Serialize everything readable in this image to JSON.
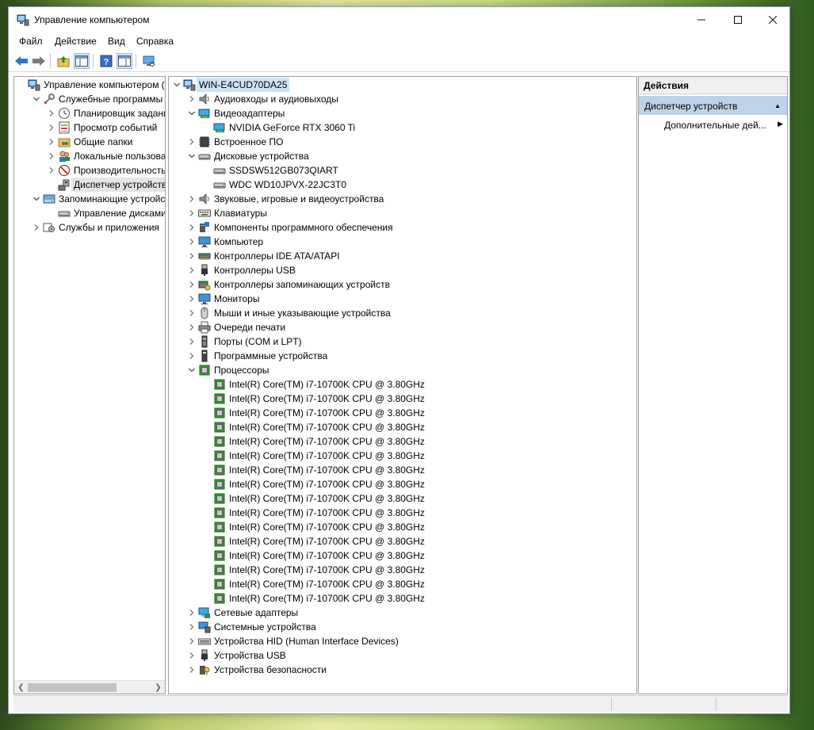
{
  "window": {
    "title": "Управление компьютером"
  },
  "menu": [
    "Файл",
    "Действие",
    "Вид",
    "Справка"
  ],
  "left_tree": [
    {
      "label": "Управление компьютером (л",
      "level": 0,
      "chev": "",
      "icon": "computer-management-icon"
    },
    {
      "label": "Служебные программы",
      "level": 1,
      "chev": "down",
      "icon": "system-tools-icon"
    },
    {
      "label": "Планировщик заданий",
      "level": 2,
      "chev": "right",
      "icon": "task-scheduler-icon"
    },
    {
      "label": "Просмотр событий",
      "level": 2,
      "chev": "right",
      "icon": "event-viewer-icon"
    },
    {
      "label": "Общие папки",
      "level": 2,
      "chev": "right",
      "icon": "shared-folders-icon"
    },
    {
      "label": "Локальные пользовате",
      "level": 2,
      "chev": "right",
      "icon": "local-users-icon"
    },
    {
      "label": "Производительность",
      "level": 2,
      "chev": "right",
      "icon": "performance-icon"
    },
    {
      "label": "Диспетчер устройств",
      "level": 2,
      "chev": "",
      "icon": "device-manager-icon",
      "selected": true
    },
    {
      "label": "Запоминающие устройст",
      "level": 1,
      "chev": "down",
      "icon": "storage-icon"
    },
    {
      "label": "Управление дисками",
      "level": 2,
      "chev": "",
      "icon": "disk-management-icon"
    },
    {
      "label": "Службы и приложения",
      "level": 1,
      "chev": "right",
      "icon": "services-apps-icon"
    }
  ],
  "device_tree": [
    {
      "label": "WIN-E4CUD70DA25",
      "level": 0,
      "chev": "down",
      "icon": "computer-icon",
      "root": true
    },
    {
      "label": "Аудиовходы и аудиовыходы",
      "level": 1,
      "chev": "right",
      "icon": "audio-icon"
    },
    {
      "label": "Видеоадаптеры",
      "level": 1,
      "chev": "down",
      "icon": "display-adapter-icon"
    },
    {
      "label": "NVIDIA GeForce RTX 3060 Ti",
      "level": 2,
      "chev": "",
      "icon": "display-adapter-icon"
    },
    {
      "label": "Встроенное ПО",
      "level": 1,
      "chev": "right",
      "icon": "firmware-icon"
    },
    {
      "label": "Дисковые устройства",
      "level": 1,
      "chev": "down",
      "icon": "disk-drive-icon"
    },
    {
      "label": "SSDSW512GB073QIART",
      "level": 2,
      "chev": "",
      "icon": "disk-drive-icon"
    },
    {
      "label": "WDC WD10JPVX-22JC3T0",
      "level": 2,
      "chev": "",
      "icon": "disk-drive-icon"
    },
    {
      "label": "Звуковые, игровые и видеоустройства",
      "level": 1,
      "chev": "right",
      "icon": "speaker-icon"
    },
    {
      "label": "Клавиатуры",
      "level": 1,
      "chev": "right",
      "icon": "keyboard-icon"
    },
    {
      "label": "Компоненты программного обеспечения",
      "level": 1,
      "chev": "right",
      "icon": "software-component-icon"
    },
    {
      "label": "Компьютер",
      "level": 1,
      "chev": "right",
      "icon": "monitor-icon"
    },
    {
      "label": "Контроллеры IDE ATA/ATAPI",
      "level": 1,
      "chev": "right",
      "icon": "ide-controller-icon"
    },
    {
      "label": "Контроллеры USB",
      "level": 1,
      "chev": "right",
      "icon": "usb-icon"
    },
    {
      "label": "Контроллеры запоминающих устройств",
      "level": 1,
      "chev": "right",
      "icon": "storage-controller-icon"
    },
    {
      "label": "Мониторы",
      "level": 1,
      "chev": "right",
      "icon": "monitor-icon"
    },
    {
      "label": "Мыши и иные указывающие устройства",
      "level": 1,
      "chev": "right",
      "icon": "mouse-icon"
    },
    {
      "label": "Очереди печати",
      "level": 1,
      "chev": "right",
      "icon": "printer-icon"
    },
    {
      "label": "Порты (COM и LPT)",
      "level": 1,
      "chev": "right",
      "icon": "port-icon"
    },
    {
      "label": "Программные устройства",
      "level": 1,
      "chev": "right",
      "icon": "software-device-icon"
    },
    {
      "label": "Процессоры",
      "level": 1,
      "chev": "down",
      "icon": "cpu-icon"
    },
    {
      "label": "Intel(R) Core(TM) i7-10700K CPU @ 3.80GHz",
      "level": 2,
      "chev": "",
      "icon": "cpu-icon"
    },
    {
      "label": "Intel(R) Core(TM) i7-10700K CPU @ 3.80GHz",
      "level": 2,
      "chev": "",
      "icon": "cpu-icon"
    },
    {
      "label": "Intel(R) Core(TM) i7-10700K CPU @ 3.80GHz",
      "level": 2,
      "chev": "",
      "icon": "cpu-icon"
    },
    {
      "label": "Intel(R) Core(TM) i7-10700K CPU @ 3.80GHz",
      "level": 2,
      "chev": "",
      "icon": "cpu-icon"
    },
    {
      "label": "Intel(R) Core(TM) i7-10700K CPU @ 3.80GHz",
      "level": 2,
      "chev": "",
      "icon": "cpu-icon"
    },
    {
      "label": "Intel(R) Core(TM) i7-10700K CPU @ 3.80GHz",
      "level": 2,
      "chev": "",
      "icon": "cpu-icon"
    },
    {
      "label": "Intel(R) Core(TM) i7-10700K CPU @ 3.80GHz",
      "level": 2,
      "chev": "",
      "icon": "cpu-icon"
    },
    {
      "label": "Intel(R) Core(TM) i7-10700K CPU @ 3.80GHz",
      "level": 2,
      "chev": "",
      "icon": "cpu-icon"
    },
    {
      "label": "Intel(R) Core(TM) i7-10700K CPU @ 3.80GHz",
      "level": 2,
      "chev": "",
      "icon": "cpu-icon"
    },
    {
      "label": "Intel(R) Core(TM) i7-10700K CPU @ 3.80GHz",
      "level": 2,
      "chev": "",
      "icon": "cpu-icon"
    },
    {
      "label": "Intel(R) Core(TM) i7-10700K CPU @ 3.80GHz",
      "level": 2,
      "chev": "",
      "icon": "cpu-icon"
    },
    {
      "label": "Intel(R) Core(TM) i7-10700K CPU @ 3.80GHz",
      "level": 2,
      "chev": "",
      "icon": "cpu-icon"
    },
    {
      "label": "Intel(R) Core(TM) i7-10700K CPU @ 3.80GHz",
      "level": 2,
      "chev": "",
      "icon": "cpu-icon"
    },
    {
      "label": "Intel(R) Core(TM) i7-10700K CPU @ 3.80GHz",
      "level": 2,
      "chev": "",
      "icon": "cpu-icon"
    },
    {
      "label": "Intel(R) Core(TM) i7-10700K CPU @ 3.80GHz",
      "level": 2,
      "chev": "",
      "icon": "cpu-icon"
    },
    {
      "label": "Intel(R) Core(TM) i7-10700K CPU @ 3.80GHz",
      "level": 2,
      "chev": "",
      "icon": "cpu-icon"
    },
    {
      "label": "Сетевые адаптеры",
      "level": 1,
      "chev": "right",
      "icon": "network-adapter-icon"
    },
    {
      "label": "Системные устройства",
      "level": 1,
      "chev": "right",
      "icon": "system-devices-icon"
    },
    {
      "label": "Устройства HID (Human Interface Devices)",
      "level": 1,
      "chev": "right",
      "icon": "hid-icon"
    },
    {
      "label": "Устройства USB",
      "level": 1,
      "chev": "right",
      "icon": "usb-icon"
    },
    {
      "label": "Устройства безопасности",
      "level": 1,
      "chev": "right",
      "icon": "security-device-icon"
    }
  ],
  "actions": {
    "header": "Действия",
    "section": "Диспетчер устройств",
    "item": "Дополнительные дей..."
  },
  "colors": {
    "selection": "#cce4f7",
    "actions_section": "#bcd3ea",
    "chevron": "#555555"
  }
}
